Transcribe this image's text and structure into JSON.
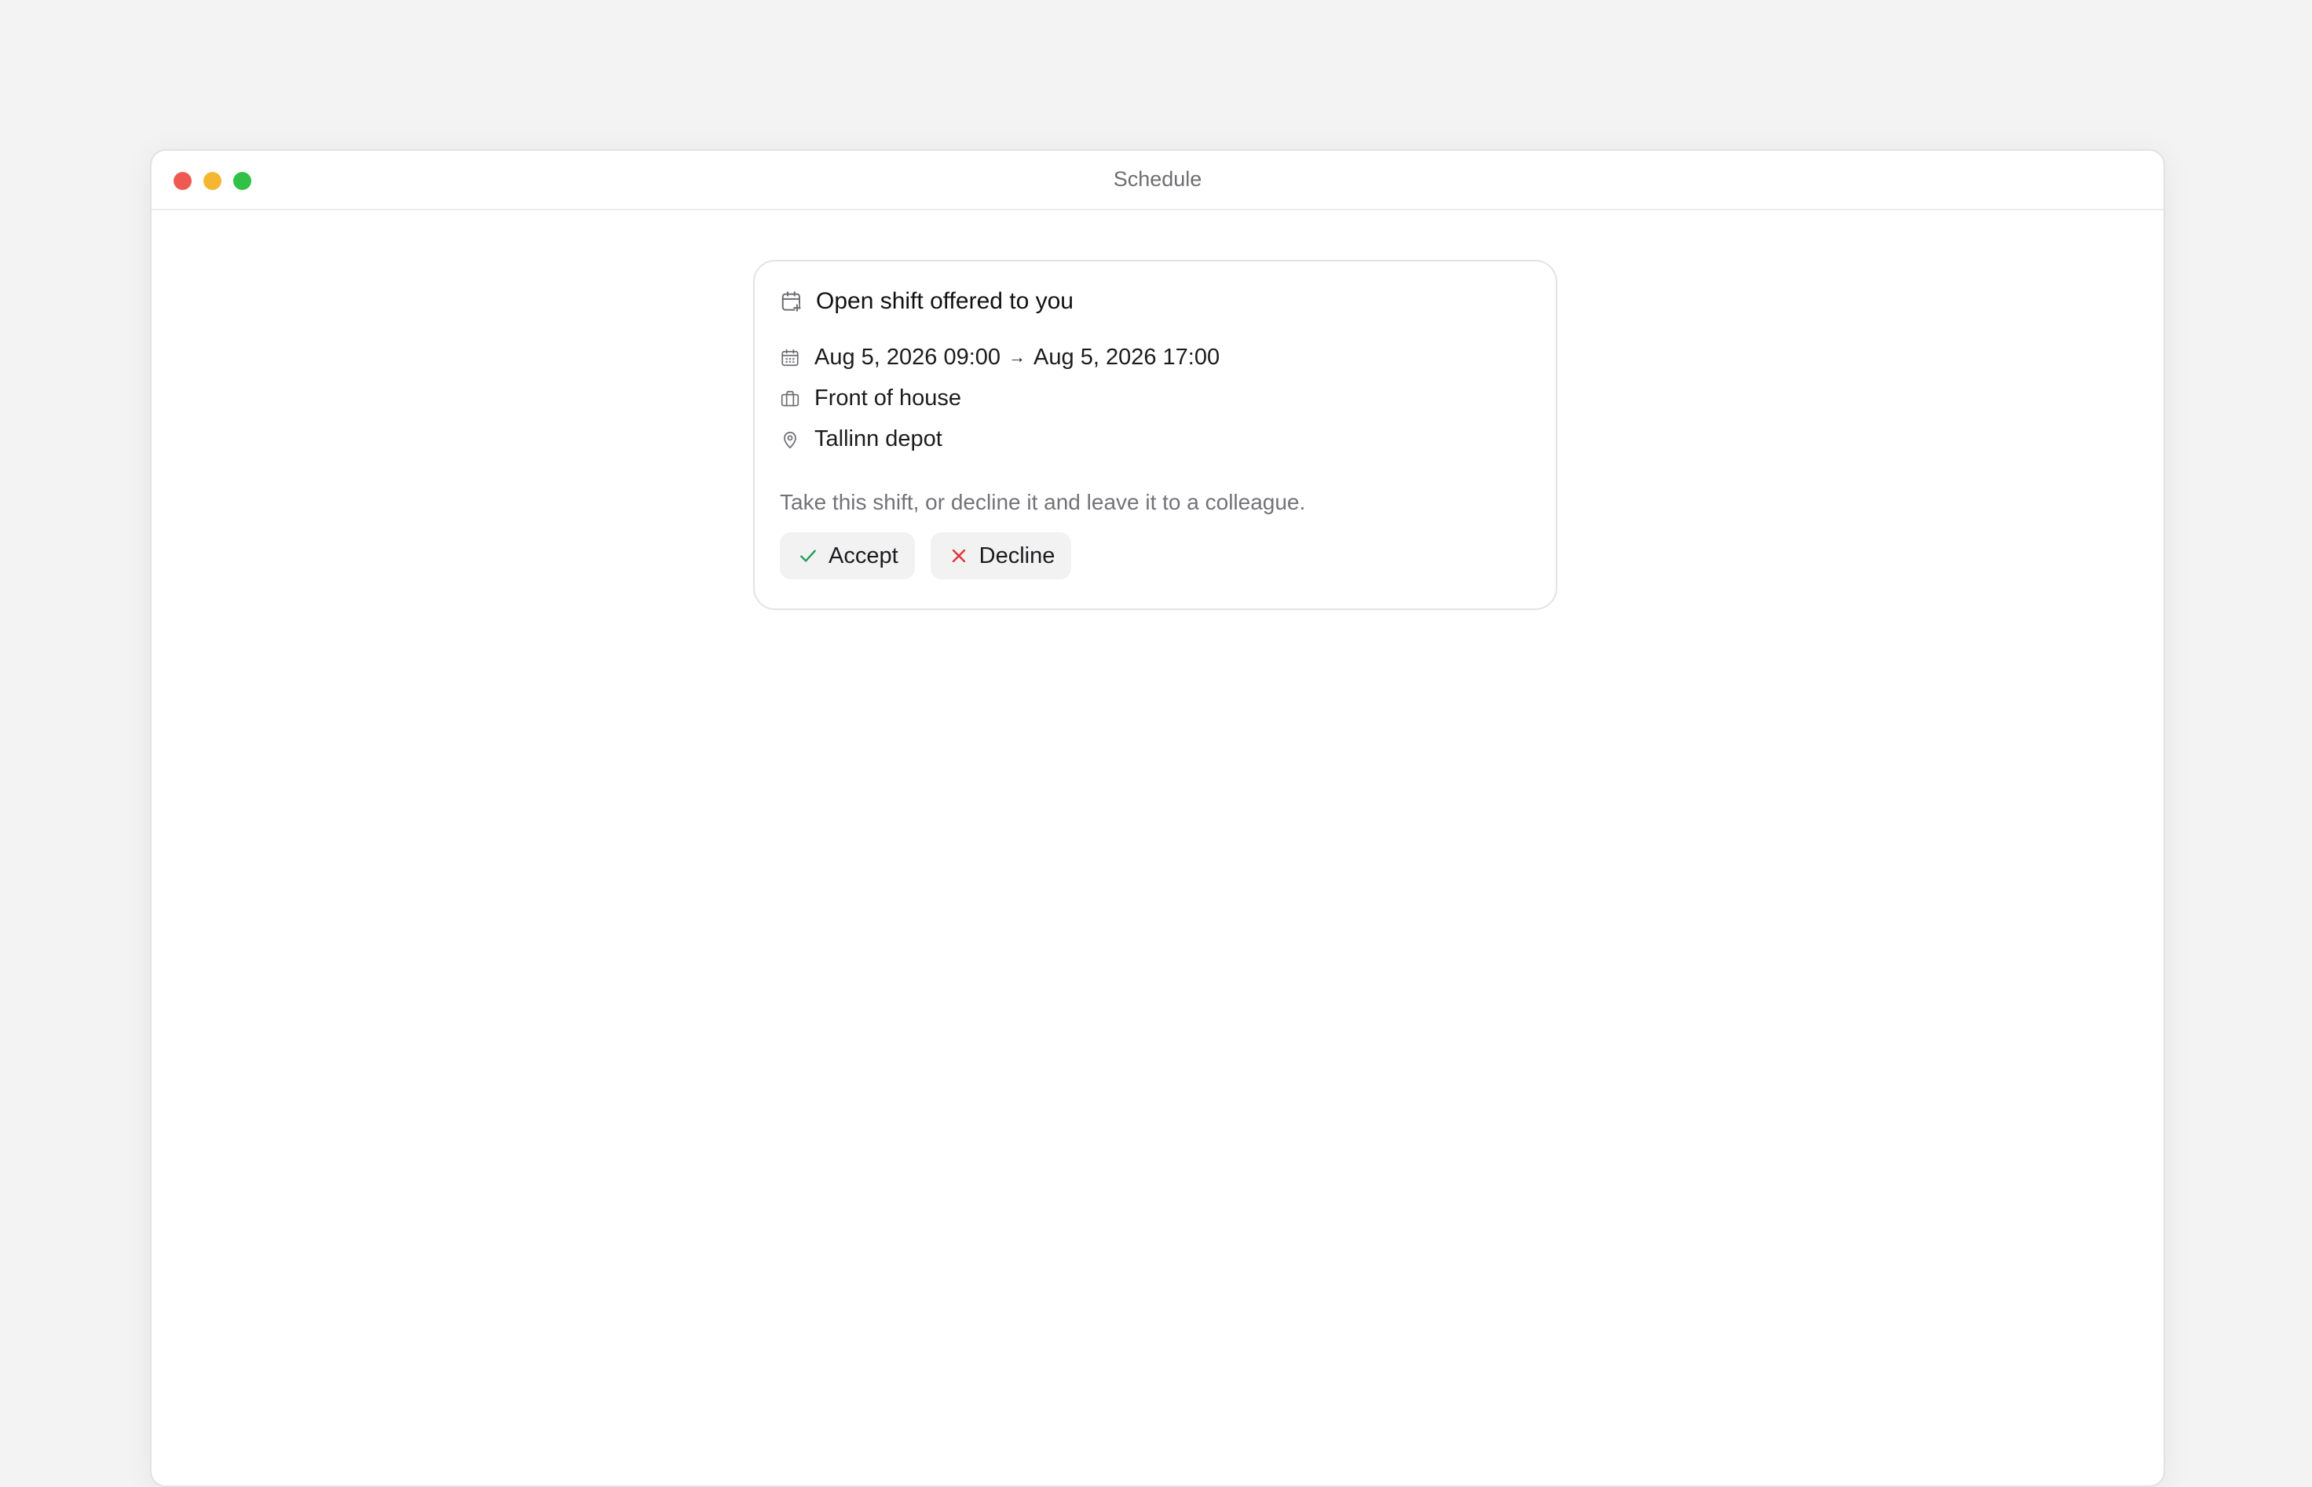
{
  "window": {
    "title": "Schedule"
  },
  "card": {
    "header_icon": "calendar-plus-icon",
    "title": "Open shift offered to you",
    "rows": [
      {
        "icon": "calendar-icon",
        "start": "Aug 5, 2026 09:00",
        "separator": "→",
        "end": "Aug 5, 2026 17:00"
      },
      {
        "icon": "briefcase-icon",
        "text": "Front of house"
      },
      {
        "icon": "map-pin-icon",
        "text": "Tallinn depot"
      }
    ],
    "description": "Take this shift, or decline it and leave it to a colleague.",
    "actions": {
      "accept_label": "Accept",
      "decline_label": "Decline"
    }
  },
  "colors": {
    "accept_accent": "#1e9e55",
    "decline_accent": "#e03131",
    "icon_stroke": "#6e6e73"
  }
}
